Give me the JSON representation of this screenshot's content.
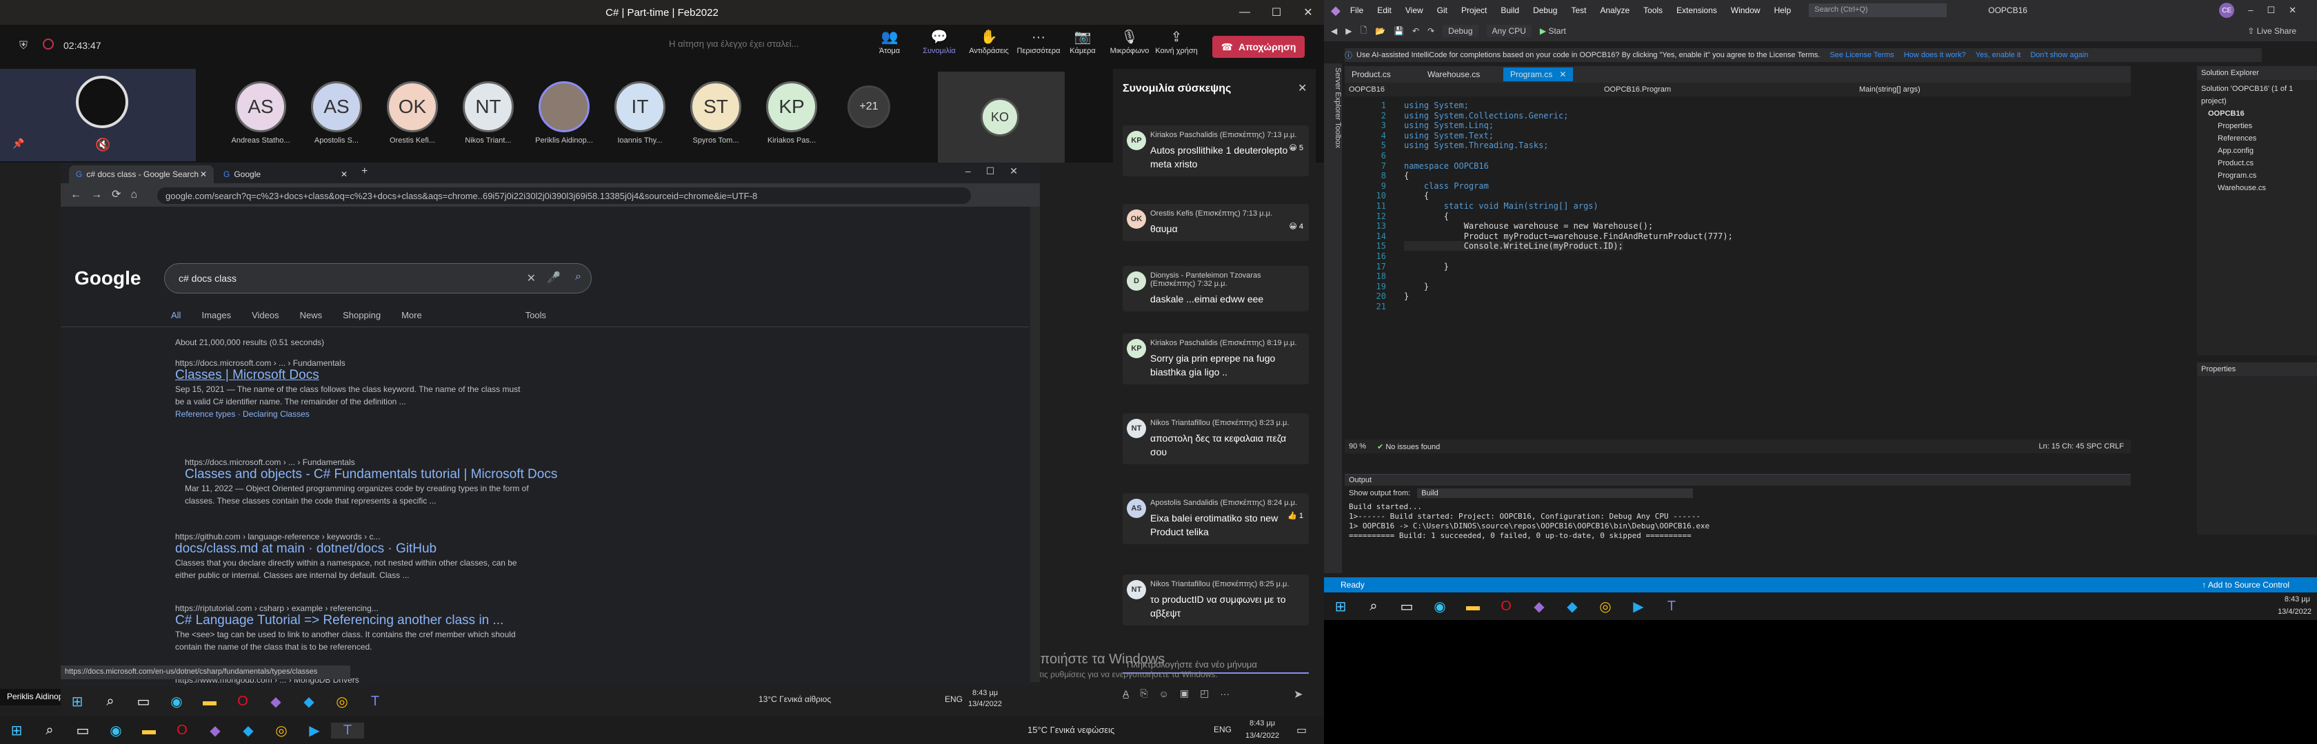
{
  "teams": {
    "window_title": "C# | Part-time | Feb2022",
    "timer": "02:43:47",
    "search_placeholder": "Η αίτηση για έλεγχο έχει σταλεί...",
    "toolbar": [
      "Άτομα",
      "Συνομιλία",
      "Αντιδράσεις",
      "Περισσότερα",
      "Κάμερα",
      "Μικρόφωνο",
      "Κοινή χρήση"
    ],
    "leave_label": "Αποχώρηση",
    "participants": [
      {
        "initials": "AS",
        "name": "Andreas Statho...",
        "color": "#e8d6e8"
      },
      {
        "initials": "AS",
        "name": "Apostolis S...",
        "color": "#c8d4ee"
      },
      {
        "initials": "OK",
        "name": "Orestis Kefi...",
        "color": "#f2d2c2"
      },
      {
        "initials": "NT",
        "name": "Nikos Triant...",
        "color": "#e0e6ea"
      },
      {
        "initials": "",
        "name": "Periklis Aidinop...",
        "color": "#8a7a70"
      },
      {
        "initials": "IT",
        "name": "Ioannis Thy...",
        "color": "#cfe0f2"
      },
      {
        "initials": "ST",
        "name": "Spyros Tom...",
        "color": "#f2e4c0"
      },
      {
        "initials": "KP",
        "name": "Kiriakos Pas...",
        "color": "#d4ecd4"
      }
    ],
    "more_count": "+21",
    "extra_tile": "KO",
    "presenter_label": "Periklis Aidinopoulos",
    "activate_windows": "Ενεργοποιήστε τα Windows",
    "activate_windows_sub": "Μεταβείτε στις ρυθμίσεις για να ενεργοποιήσετε τα Windows."
  },
  "chat": {
    "title": "Συνομιλία σύσκεψης",
    "compose_placeholder": "Πληκτρολογήστε ένα νέο μήνυμα",
    "messages": [
      {
        "ini": "KP",
        "color": "#d4ecd4",
        "who": "Kiriakos Paschalidis (Επισκέπτης)",
        "time": "7:13 μ.μ.",
        "text": "Autos prosllithike 1 deuterolepto meta xristo",
        "react": "😀 5"
      },
      {
        "ini": "OK",
        "color": "#f2d2c2",
        "who": "Orestis Kefis (Επισκέπτης)",
        "time": "7:13 μ.μ.",
        "text": "θαυμα",
        "react": "😀 4"
      },
      {
        "ini": "D",
        "color": "#d6e8d6",
        "who": "Dionysis - Panteleimon Tzovaras (Επισκέπτης)",
        "time": "7:32 μ.μ.",
        "text": "daskale ...eimai edww eee",
        "react": ""
      },
      {
        "ini": "KP",
        "color": "#d4ecd4",
        "who": "Kiriakos Paschalidis (Επισκέπτης)",
        "time": "8:19 μ.μ.",
        "text": "Sorry gia prin eprepe na fugo biasthka gia ligo ..",
        "react": ""
      },
      {
        "ini": "NT",
        "color": "#e0e6ea",
        "who": "Nikos Triantafillou (Επισκέπτης)",
        "time": "8:23 μ.μ.",
        "text": "αποστολη δες τα κεφαλαια πεζα σου",
        "react": ""
      },
      {
        "ini": "AS",
        "color": "#c8d4ee",
        "who": "Apostolis Sandalidis (Επισκέπτης)",
        "time": "8:24 μ.μ.",
        "text": "Eixa balei erotimatiko sto new Product telika",
        "react": "👍 1"
      },
      {
        "ini": "NT",
        "color": "#e0e6ea",
        "who": "Nikos Triantafillou (Επισκέπτης)",
        "time": "8:25 μ.μ.",
        "text": "το productID να συμφωνει με το αβξεψτ",
        "react": ""
      }
    ]
  },
  "chrome": {
    "tabs": [
      "c# docs class - Google Search",
      "Google"
    ],
    "url": "google.com/search?q=c%23+docs+class&oq=c%23+docs+class&aqs=chrome..69i57j0i22i30l2j0i390l3j69i58.13385j0j4&sourceid=chrome&ie=UTF-8",
    "query": "c# docs class",
    "tabs_row": [
      "All",
      "Images",
      "Videos",
      "News",
      "Shopping",
      "More",
      "Tools"
    ],
    "stats": "About 21,000,000 results (0.51 seconds)",
    "results": [
      {
        "url": "https://docs.microsoft.com › ... › Fundamentals",
        "title": "Classes | Microsoft Docs",
        "snip1": "Sep 15, 2021 — The name of the class follows the class keyword. The name of the class must",
        "snip2": "be a valid C# identifier name. The remainder of the definition ...",
        "links": "Reference types · Declaring Classes"
      },
      {
        "url": "https://docs.microsoft.com › ... › Fundamentals",
        "title": "Classes and objects - C# Fundamentals tutorial | Microsoft Docs",
        "snip1": "Mar 11, 2022 — Object Oriented programming organizes code by creating types in the form of",
        "snip2": "classes. These classes contain the code that represents a specific ...",
        "links": ""
      },
      {
        "url": "https://github.com › language-reference › keywords › c...",
        "title": "docs/class.md at main · dotnet/docs · GitHub",
        "snip1": "Classes that you declare directly within a namespace, not nested within other classes, can be",
        "snip2": "either public or internal. Classes are internal by default. Class ...",
        "links": ""
      },
      {
        "url": "https://riptutorial.com › csharp › example › referencing...",
        "title": "C# Language Tutorial => Referencing another class in ...",
        "snip1": "The <see> tag can be used to link to another class. It contains the cref member which should",
        "snip2": "contain the name of the class that is to be referenced.",
        "links": ""
      },
      {
        "url": "https://www.mongodb.com › ... › MongoDB Drivers",
        "title": "",
        "snip1": "",
        "snip2": "",
        "links": ""
      }
    ],
    "status_url": "https://docs.microsoft.com/en-us/dotnet/csharp/fundamentals/types/classes"
  },
  "taskbar_left": {
    "weather": "13°C Γενικά αίθριος",
    "lang": "ENG",
    "time": "8:43 μμ",
    "date": "13/4/2022"
  },
  "taskbar_main": {
    "weather": "15°C Γενικά νεφώσεις",
    "lang": "ENG",
    "time": "8:43 μμ",
    "date": "13/4/2022"
  },
  "vs": {
    "menu": [
      "File",
      "Edit",
      "View",
      "Git",
      "Project",
      "Build",
      "Debug",
      "Test",
      "Analyze",
      "Tools",
      "Extensions",
      "Window",
      "Help"
    ],
    "search": "Search (Ctrl+Q)",
    "solution_name": "OOPCB16",
    "config": "Debug",
    "platform": "Any CPU",
    "start": "Start",
    "live_share": "Live Share",
    "banner": "Use AI-assisted IntelliCode for completions based on your code in OOPCB16? By clicking \"Yes, enable it\" you agree to the License Terms.",
    "banner_links": [
      "See License Terms",
      "How does it work?",
      "Yes, enable it",
      "Don't show again"
    ],
    "doc_tabs": [
      "Product.cs",
      "Warehouse.cs",
      "Program.cs"
    ],
    "nav": [
      "OOPCB16",
      "OOPCB16.Program",
      "Main(string[] args)"
    ],
    "code": [
      "using System;",
      "using System.Collections.Generic;",
      "using System.Linq;",
      "using System.Text;",
      "using System.Threading.Tasks;",
      "",
      "namespace OOPCB16",
      "{",
      "    class Program",
      "    {",
      "        static void Main(string[] args)",
      "        {",
      "            Warehouse warehouse = new Warehouse();",
      "            Product myProduct=warehouse.FindAndReturnProduct(777);",
      "            Console.WriteLine(myProduct.ID);",
      "",
      "        }",
      "",
      "    }",
      "}",
      ""
    ],
    "zoom": "90 %",
    "issues": "No issues found",
    "cursor": "Ln: 15   Ch: 45   SPC   CRLF",
    "solution_explorer": "Solution Explorer",
    "se_items": [
      "Solution 'OOPCB16' (1 of 1 project)",
      "OOPCB16",
      "Properties",
      "References",
      "App.config",
      "Product.cs",
      "Program.cs",
      "Warehouse.cs"
    ],
    "properties": "Properties",
    "output_title": "Output",
    "output_from": "Show output from:",
    "output_source": "Build",
    "output_lines": [
      "Build started...",
      "1>------ Build started: Project: OOPCB16, Configuration: Debug Any CPU ------",
      "1>  OOPCB16 -> C:\\Users\\DINOS\\source\\repos\\OOPCB16\\OOPCB16\\bin\\Debug\\OOPCB16.exe",
      "========== Build: 1 succeeded, 0 failed, 0 up-to-date, 0 skipped =========="
    ],
    "status": "Ready",
    "source_control": "Add to Source Control"
  }
}
